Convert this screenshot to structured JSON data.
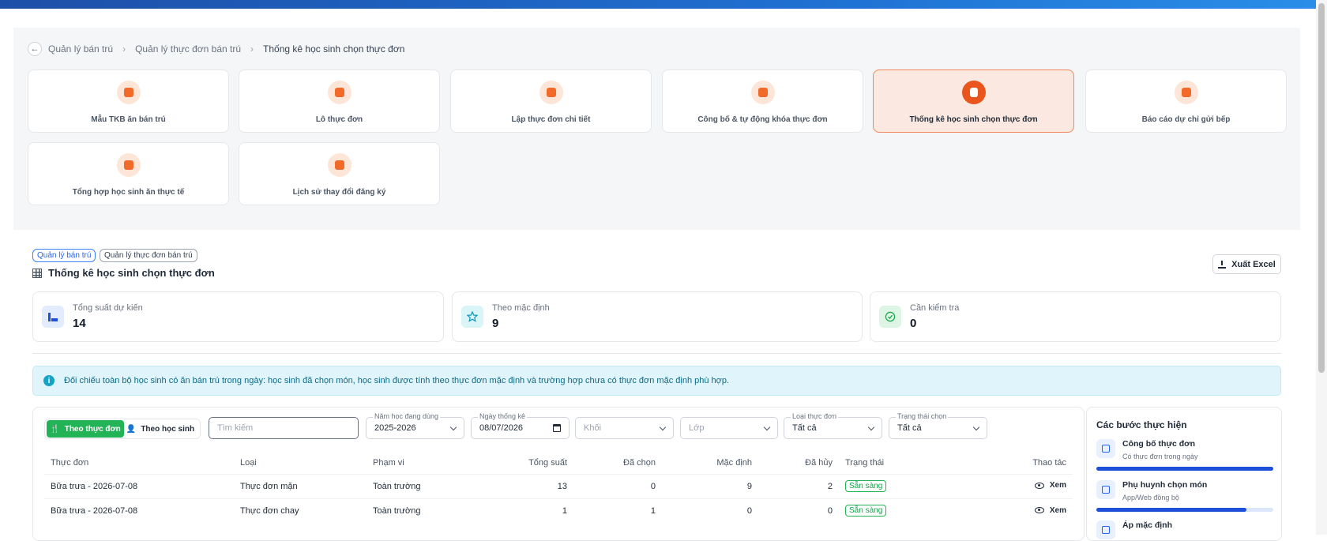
{
  "breadcrumb": {
    "items": [
      "Quản lý bán trú",
      "Quản lý thực đơn bán trú",
      "Thống kê học sinh chọn thực đơn"
    ]
  },
  "nav_cards": [
    {
      "label": "Mẫu TKB ăn bán trú",
      "icon": "calendar-icon"
    },
    {
      "label": "Lô thực đơn",
      "icon": "box-icon"
    },
    {
      "label": "Lập thực đơn chi tiết",
      "icon": "dish-icon"
    },
    {
      "label": "Công bố & tự động khóa thực đơn",
      "icon": "lock-icon"
    },
    {
      "label": "Thống kê học sinh chọn thực đơn",
      "icon": "chart-icon",
      "active": true
    },
    {
      "label": "Báo cáo dự chỉ gửi bếp",
      "icon": "report-icon"
    },
    {
      "label": "Tổng hợp học sinh ăn thực tế",
      "icon": "tray-icon"
    },
    {
      "label": "Lịch sử thay đổi đăng ký",
      "icon": "history-icon"
    }
  ],
  "tags": [
    "Quản lý bán trú",
    "Quản lý thực đơn bán trú"
  ],
  "page_title": "Thống kê học sinh chọn thực đơn",
  "export_label": "Xuất Excel",
  "stats": [
    {
      "label": "Tổng suất dự kiến",
      "value": "14",
      "icon": "bar-chart-icon"
    },
    {
      "label": "Theo mặc định",
      "value": "9",
      "icon": "star-icon"
    },
    {
      "label": "Cần kiểm tra",
      "value": "0",
      "icon": "check-circle-icon"
    }
  ],
  "info_text": "Đối chiếu toàn bộ học sinh có ăn bán trú trong ngày: học sinh đã chọn món, học sinh được tính theo thực đơn mặc định và trường hợp chưa có thực đơn mặc định phù hợp.",
  "view_toggle": {
    "active": "Theo thực đơn",
    "inactive": "Theo học sinh"
  },
  "filters": {
    "search_placeholder": "Tìm kiếm",
    "school_year_label": "Năm học đang dùng",
    "school_year_value": "2025-2026",
    "date_label": "Ngày thống kê",
    "date_value": "08/07/2026",
    "grade_placeholder": "Khối",
    "class_placeholder": "Lớp",
    "menu_type_label": "Loại thực đơn",
    "menu_type_value": "Tất cả",
    "status_label": "Trạng thái chọn",
    "status_value": "Tất cả"
  },
  "table": {
    "headers": [
      "Thực đơn",
      "Loại",
      "Phạm vi",
      "Tổng suất",
      "Đã chọn",
      "Mặc định",
      "Đã hủy",
      "Trạng thái",
      "Thao tác"
    ],
    "rows": [
      {
        "menu": "Bữa trưa - 2026-07-08",
        "type": "Thực đơn mặn",
        "scope": "Toàn trường",
        "total": "13",
        "chosen": "0",
        "default": "9",
        "cancelled": "2",
        "status": "Sẵn sàng",
        "action": "Xem"
      },
      {
        "menu": "Bữa trưa - 2026-07-08",
        "type": "Thực đơn chay",
        "scope": "Toàn trường",
        "total": "1",
        "chosen": "1",
        "default": "0",
        "cancelled": "0",
        "status": "Sẵn sàng",
        "action": "Xem"
      }
    ]
  },
  "steps": {
    "title": "Các bước thực hiện",
    "items": [
      {
        "title": "Công bố thực đơn",
        "desc": "Có thực đơn trong ngày",
        "progress": 1.0,
        "icon": "send-icon"
      },
      {
        "title": "Phụ huynh chọn món",
        "desc": "App/Web đồng bộ",
        "progress": 0.85,
        "icon": "phone-icon"
      },
      {
        "title": "Áp mặc định",
        "desc": "",
        "progress": 0,
        "icon": "star-icon"
      }
    ]
  },
  "colors": {
    "accent": "#e9551c",
    "brand_blue": "#1e4fa8",
    "success": "#22b357",
    "info_bg": "#e0f5fb"
  }
}
